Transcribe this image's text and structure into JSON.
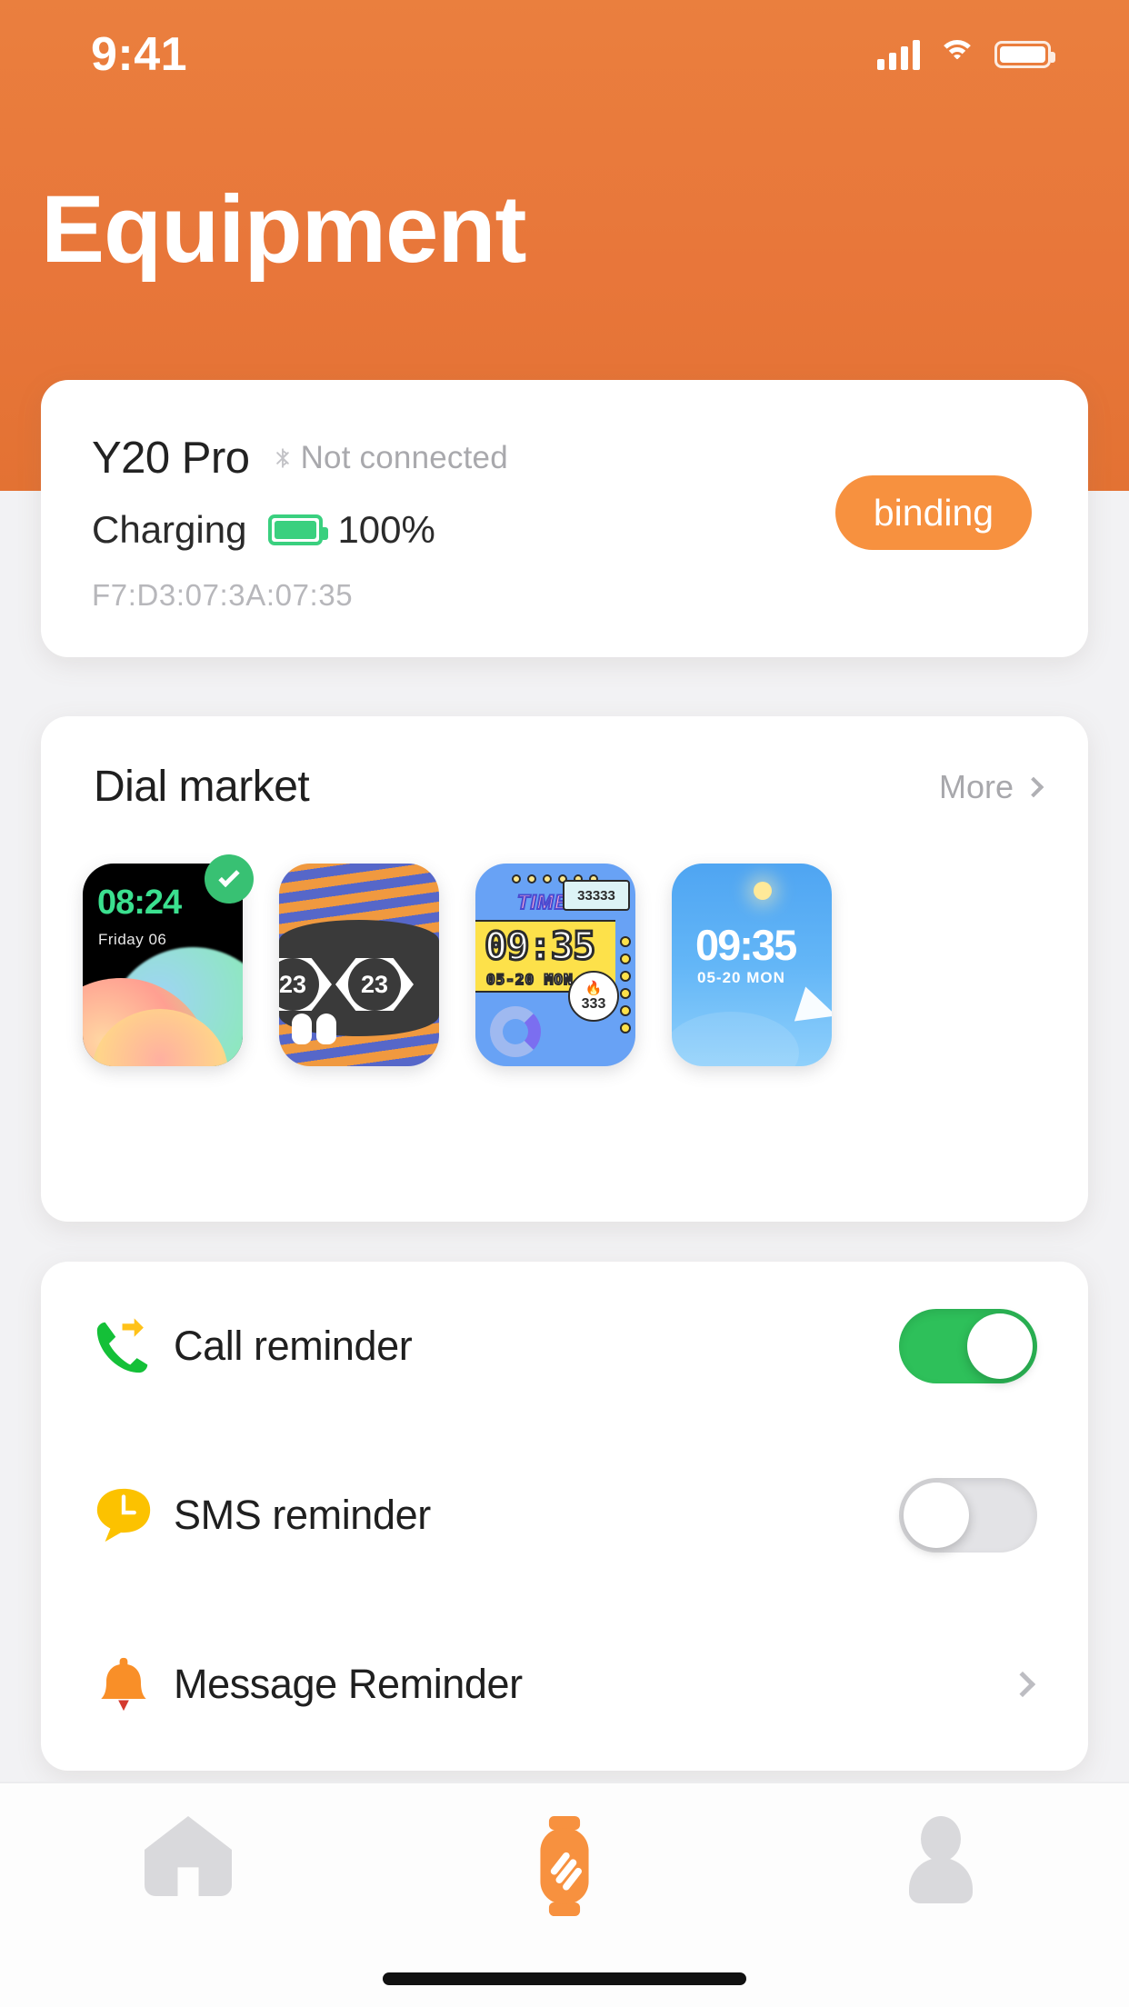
{
  "status_bar": {
    "time": "9:41",
    "icons": [
      "cellular-signal-icon",
      "wifi-icon",
      "battery-icon"
    ]
  },
  "header": {
    "title": "Equipment",
    "background_color": "#e8763a"
  },
  "device_card": {
    "name": "Y20 Pro",
    "connection_status": "Not connected",
    "connection_icon": "bluetooth-disconnected-icon",
    "charging_label": "Charging",
    "battery_percent": "100%",
    "battery_color": "#3ad07f",
    "mac_address": "F7:D3:07:3A:07:35",
    "bind_button_label": "binding",
    "bind_button_color": "#f7913f"
  },
  "dial_market": {
    "title": "Dial market",
    "more_label": "More",
    "items": [
      {
        "name": "gradient-blob-dial",
        "time": "08:24",
        "date": "Friday 06",
        "selected": true
      },
      {
        "name": "eyes-stripes-dial",
        "left_number": "23",
        "right_number": "23",
        "selected": false
      },
      {
        "name": "retro-pixel-dial",
        "label": "TIME",
        "steps": "33333",
        "time": "09:35",
        "date": "05-20  MON",
        "calories": "333",
        "selected": false
      },
      {
        "name": "blue-sky-dial",
        "time": "09:35",
        "date": "05-20  MON",
        "selected": false
      }
    ]
  },
  "settings": {
    "rows": [
      {
        "label": "Call reminder",
        "icon": "phone-call-icon",
        "control": "toggle",
        "state": "on"
      },
      {
        "label": "SMS reminder",
        "icon": "sms-bubble-icon",
        "control": "toggle",
        "state": "off"
      },
      {
        "label": "Message Reminder",
        "icon": "bell-icon",
        "control": "chevron"
      }
    ]
  },
  "tabbar": {
    "items": [
      {
        "name": "home-icon",
        "active": false
      },
      {
        "name": "watch-icon",
        "active": true
      },
      {
        "name": "profile-icon",
        "active": false
      }
    ],
    "active_color": "#f7913f",
    "inactive_color": "#d9d9dc"
  }
}
